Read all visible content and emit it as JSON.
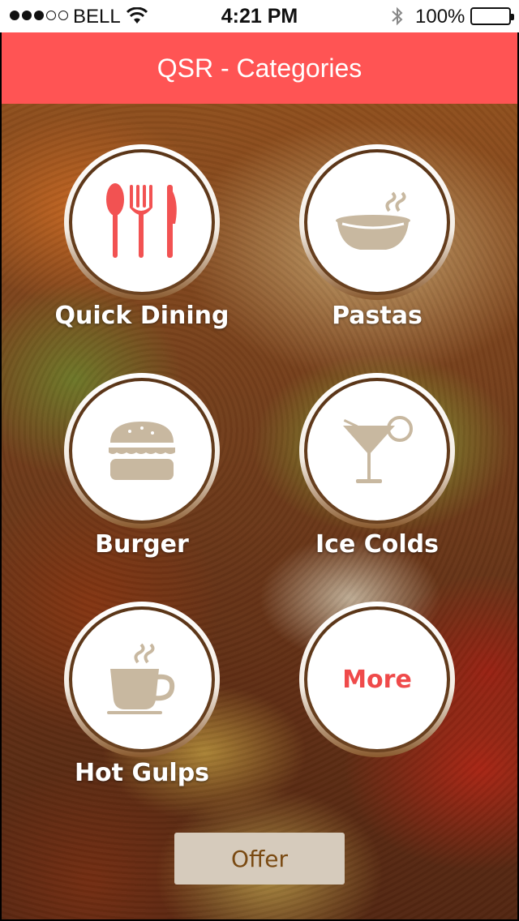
{
  "status_bar": {
    "carrier": "BELL",
    "time": "4:21 PM",
    "battery": "100%",
    "signal_strength": 3,
    "signal_max": 5
  },
  "header": {
    "title": "QSR - Categories"
  },
  "categories": [
    {
      "label": "Quick Dining",
      "icon": "cutlery-icon"
    },
    {
      "label": "Pastas",
      "icon": "bowl-icon"
    },
    {
      "label": "Burger",
      "icon": "burger-icon"
    },
    {
      "label": "Ice Colds",
      "icon": "cocktail-icon"
    },
    {
      "label": "Hot Gulps",
      "icon": "coffee-cup-icon"
    },
    {
      "label": "More"
    }
  ],
  "offer_button": {
    "label": "Offer"
  },
  "colors": {
    "accent_red": "#ff5454",
    "icon_tan": "#c8b8a0",
    "offer_bg": "#d6cbbc",
    "offer_text": "#7a4a12"
  }
}
